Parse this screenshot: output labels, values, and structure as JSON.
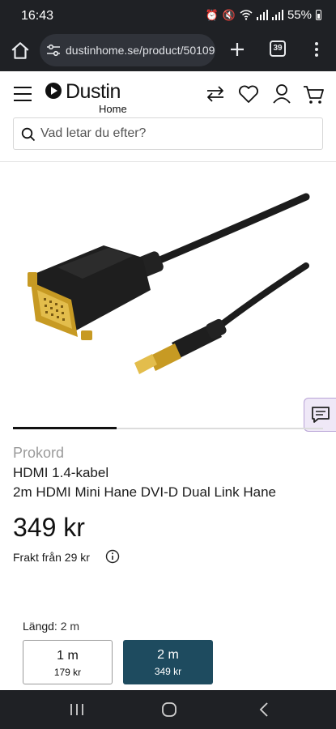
{
  "status_bar": {
    "time": "16:43",
    "battery": "55%"
  },
  "browser": {
    "url": "dustinhome.se/product/50109",
    "tab_count": "39"
  },
  "site": {
    "logo_text": "Dustin",
    "logo_subtext": "Home",
    "search_placeholder": "Vad letar du efter?"
  },
  "product": {
    "brand": "Prokord",
    "title": "HDMI 1.4-kabel",
    "subtitle": "2m HDMI Mini Hane DVI-D Dual Link Hane",
    "price": "349 kr",
    "shipping": "Frakt från 29 kr"
  },
  "length_selector": {
    "label": "Längd:",
    "selected": "2 m",
    "options": [
      {
        "size": "1 m",
        "price": "179 kr"
      },
      {
        "size": "2 m",
        "price": "349 kr"
      }
    ]
  },
  "colors": {
    "selected_option": "#1e4b5f",
    "system_bar": "#1f2125",
    "brand_text": "#9a9a9a"
  },
  "icons": [
    "alarm-icon",
    "mute-icon",
    "wifi-icon",
    "signal-icon",
    "home-icon",
    "tune-icon",
    "plus-icon",
    "tabs-icon",
    "more-vert-icon",
    "hamburger-icon",
    "compare-icon",
    "heart-icon",
    "user-icon",
    "cart-icon",
    "search-icon",
    "info-icon",
    "chat-icon",
    "recents-icon",
    "home-nav-icon",
    "back-icon"
  ]
}
